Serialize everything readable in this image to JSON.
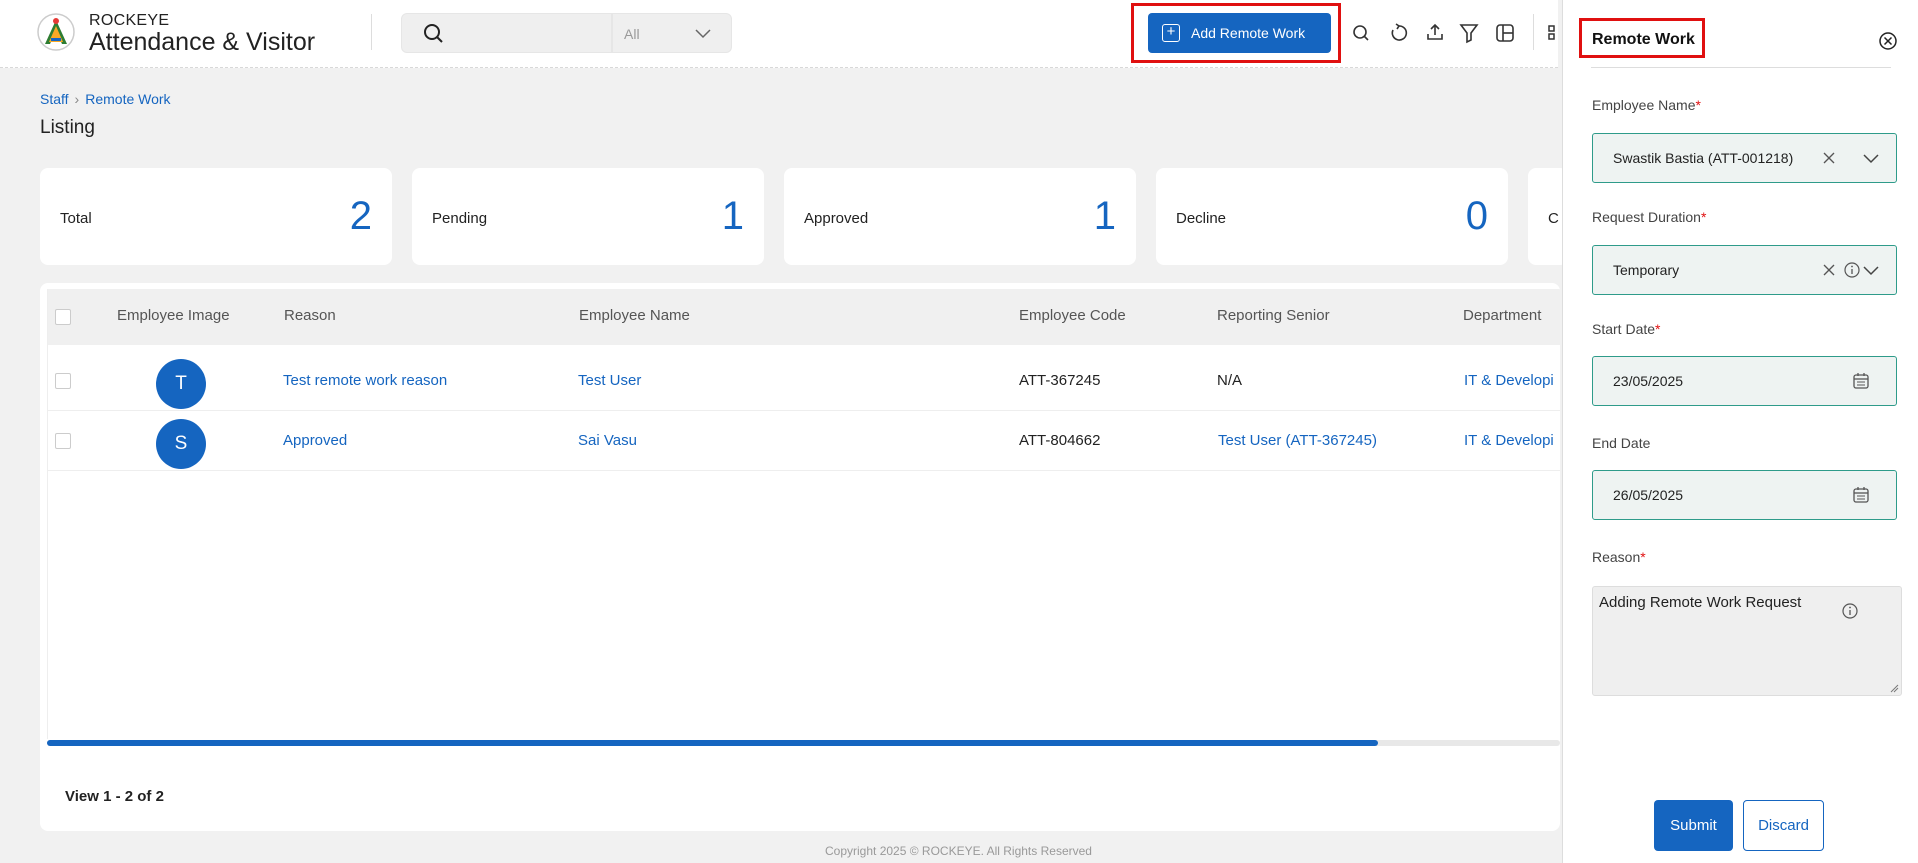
{
  "app": {
    "brand_small": "ROCKEYE",
    "brand_big": "Attendance & Visitor"
  },
  "search": {
    "placeholder": "",
    "scope": "All"
  },
  "toolbar": {
    "add_label": "Add Remote Work"
  },
  "breadcrumb": {
    "root": "Staff",
    "current": "Remote Work"
  },
  "page": {
    "title": "Listing"
  },
  "stats": [
    {
      "label": "Total",
      "value": "2"
    },
    {
      "label": "Pending",
      "value": "1"
    },
    {
      "label": "Approved",
      "value": "1"
    },
    {
      "label": "Decline",
      "value": "0"
    },
    {
      "label": "C",
      "value": ""
    }
  ],
  "table": {
    "headers": [
      "Employee Image",
      "Reason",
      "Employee Name",
      "Employee Code",
      "Reporting Senior",
      "Department"
    ],
    "rows": [
      {
        "initial": "T",
        "reason": "Test remote work reason",
        "name": "Test User",
        "code": "ATT-367245",
        "senior": "N/A",
        "dept": "IT & Developi"
      },
      {
        "initial": "S",
        "reason": "Approved",
        "name": "Sai Vasu",
        "code": "ATT-804662",
        "senior": "Test User (ATT-367245)",
        "dept": "IT & Developi"
      }
    ],
    "scroll_fraction": 0.88
  },
  "pagination": {
    "text": "View 1 - 2 of 2"
  },
  "footer": {
    "text": "Copyright 2025 © ROCKEYE. All Rights Reserved"
  },
  "drawer": {
    "title": "Remote Work",
    "fields": {
      "employee_label": "Employee Name",
      "employee_value": "Swastik Bastia (ATT-001218)",
      "duration_label": "Request Duration",
      "duration_value": "Temporary",
      "start_label": "Start Date",
      "start_value": "23/05/2025",
      "end_label": "End Date",
      "end_value": "26/05/2025",
      "reason_label": "Reason",
      "reason_value": "Adding Remote Work Request"
    },
    "required_mark": "*",
    "submit_label": "Submit",
    "discard_label": "Discard"
  },
  "colors": {
    "accent": "#1565c0",
    "highlight": "#e01010",
    "field_border": "#2e9b8a"
  }
}
